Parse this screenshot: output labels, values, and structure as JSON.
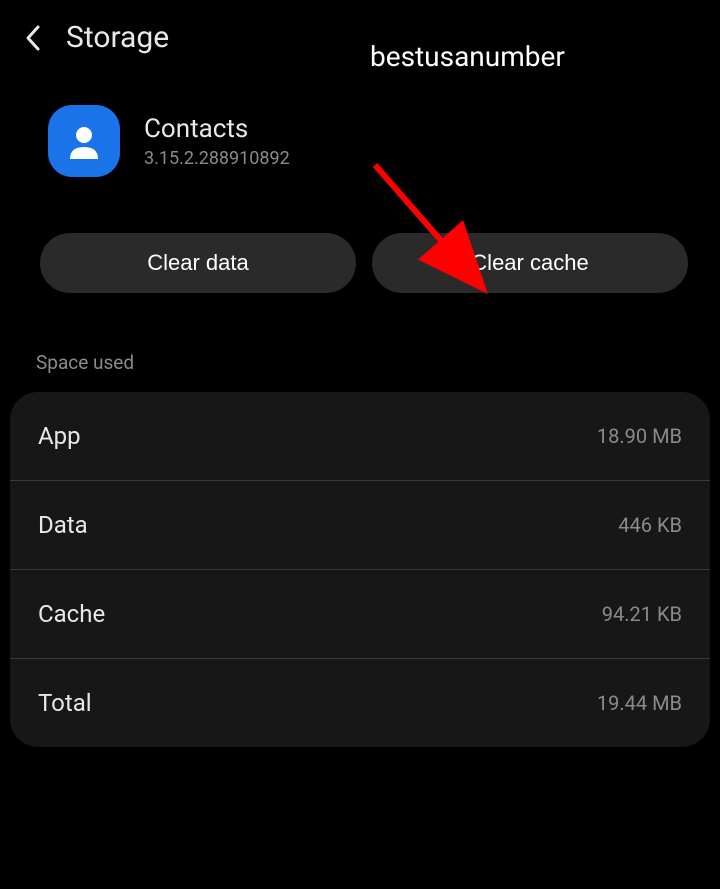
{
  "header": {
    "title": "Storage"
  },
  "watermark": "bestusanumber",
  "app": {
    "name": "Contacts",
    "version": "3.15.2.288910892"
  },
  "actions": {
    "clear_data": "Clear data",
    "clear_cache": "Clear cache"
  },
  "space_section": {
    "title": "Space used",
    "rows": [
      {
        "label": "App",
        "value": "18.90 MB"
      },
      {
        "label": "Data",
        "value": "446 KB"
      },
      {
        "label": "Cache",
        "value": "94.21 KB"
      },
      {
        "label": "Total",
        "value": "19.44 MB"
      }
    ]
  },
  "colors": {
    "accent": "#1a73e8",
    "arrow": "#ff0000"
  }
}
